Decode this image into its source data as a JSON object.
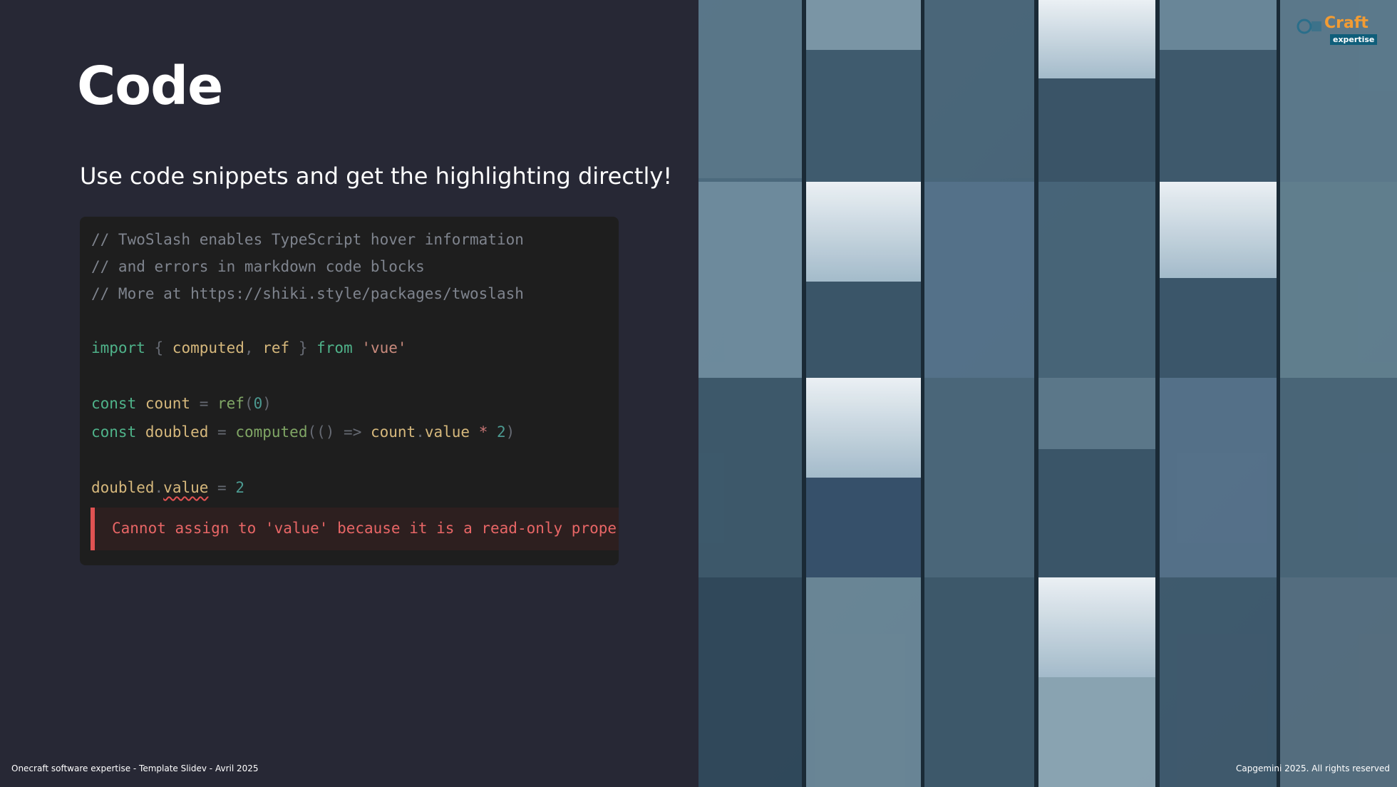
{
  "slide": {
    "title": "Code",
    "subtitle": "Use code snippets and get the highlighting directly!"
  },
  "code": {
    "line1": "// TwoSlash enables TypeScript hover information",
    "line2": "// and errors in markdown code blocks",
    "line3": "// More at https://shiki.style/packages/twoslash",
    "import_kw": "import",
    "brace_open": " { ",
    "computed": "computed",
    "comma": ", ",
    "ref": "ref",
    "brace_close": " } ",
    "from_kw": "from",
    "vue_str": " 'vue'",
    "const_kw": "const",
    "count_var": " count",
    "eq": " = ",
    "ref_fn": "ref",
    "paren_open": "(",
    "zero": "0",
    "paren_close": ")",
    "doubled_var": " doubled",
    "computed_fn": "computed",
    "arrow_part1": "(() ",
    "arrow": "=>",
    "count2": " count",
    "dot": ".",
    "value_prop": "value",
    "times": " * ",
    "two": "2",
    "close": ")",
    "doubled2": "doubled",
    "dot2": ".",
    "value2": "value",
    "eq2": " = ",
    "two2": "2",
    "error": "Cannot assign to 'value' because it is a read-only property"
  },
  "footer": {
    "left": "Onecraft software expertise - Template Slidev - Avril 2025",
    "right": "Capgemini 2025. All rights reserved"
  },
  "logo": {
    "text": "Craft",
    "sub": "expertise"
  },
  "colors": {
    "background": "#272835",
    "code_bg": "#1e1e1e",
    "error_accent": "#e05252",
    "logo_orange": "#f39c33"
  }
}
